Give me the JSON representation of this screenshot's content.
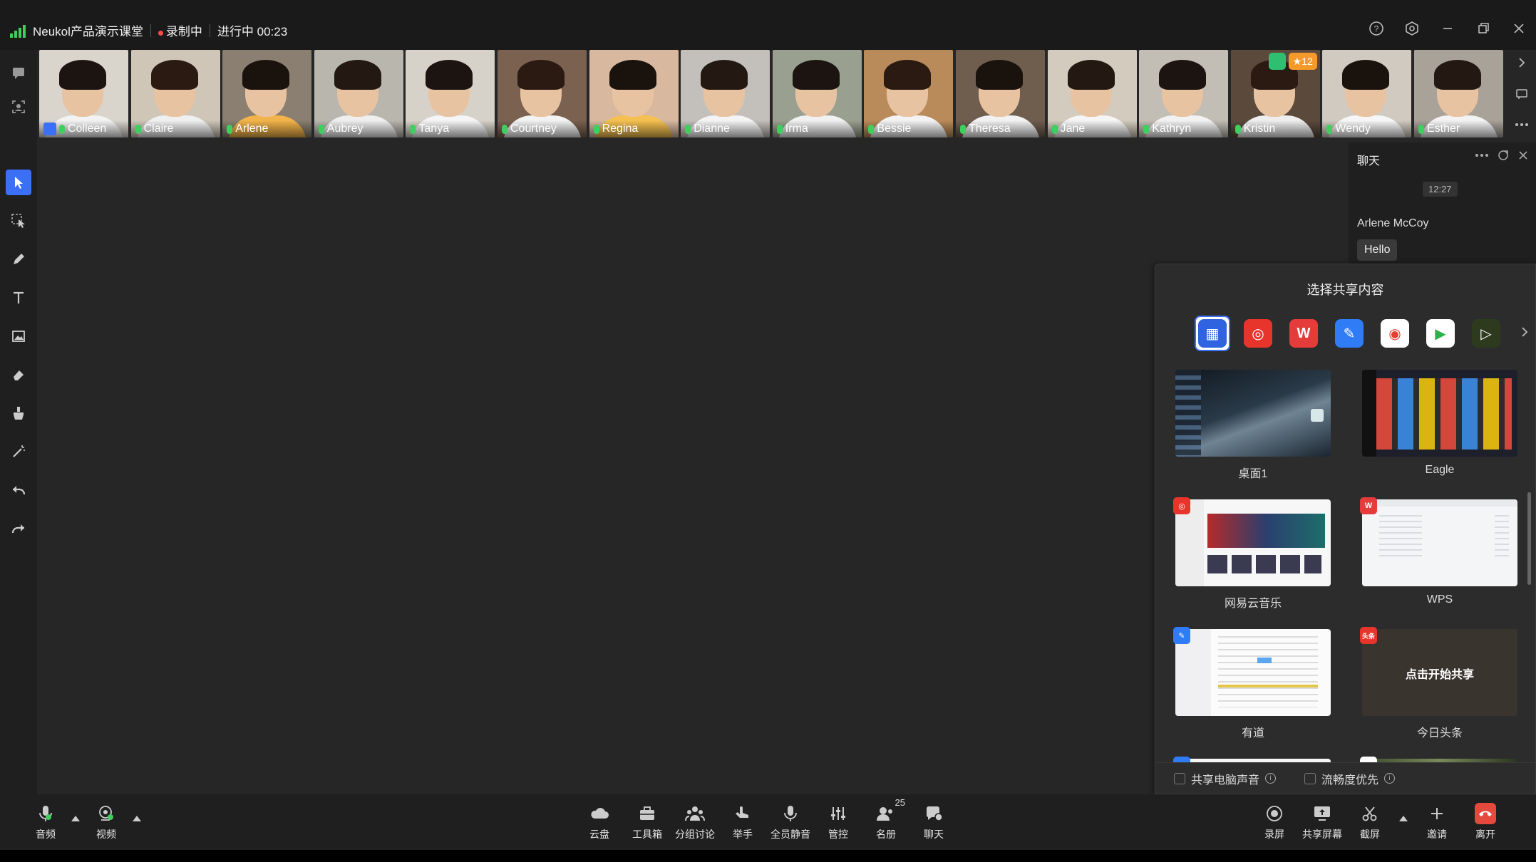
{
  "titlebar": {
    "title": "Neukol产品演示课堂",
    "recording": "录制中",
    "status": "进行中 00:23"
  },
  "participants": [
    {
      "name": "Colleen",
      "host": true,
      "bg": "#d9d4cc",
      "shirt": "#f3f3f3"
    },
    {
      "name": "Claire",
      "host": false,
      "bg": "#cfc6b8",
      "shirt": "#f0f0f0"
    },
    {
      "name": "Arlene",
      "host": false,
      "bg": "#8a7f70",
      "shirt": "#f2b34a"
    },
    {
      "name": "Aubrey",
      "host": false,
      "bg": "#b9b6ae",
      "shirt": "#efefef"
    },
    {
      "name": "Tanya",
      "host": false,
      "bg": "#d7d2c9",
      "shirt": "#f5f5f5"
    },
    {
      "name": "Courtney",
      "host": false,
      "bg": "#7a6150",
      "shirt": "#f3f3f3"
    },
    {
      "name": "Regina",
      "host": false,
      "bg": "#d8b9a0",
      "shirt": "#f5c050"
    },
    {
      "name": "Dianne",
      "host": false,
      "bg": "#c3c0bb",
      "shirt": "#f4f4f4"
    },
    {
      "name": "Irma",
      "host": false,
      "bg": "#9aa08f",
      "shirt": "#f1f1f1"
    },
    {
      "name": "Bessie",
      "host": false,
      "bg": "#b98a5a",
      "shirt": "#f3f3f3"
    },
    {
      "name": "Theresa",
      "host": false,
      "bg": "#6f5d4e",
      "shirt": "#f2f2f2"
    },
    {
      "name": "Jane",
      "host": false,
      "bg": "#d3cbbd",
      "shirt": "#f5f5f5"
    },
    {
      "name": "Kathryn",
      "host": false,
      "bg": "#c2bdb5",
      "shirt": "#f2f2f2"
    },
    {
      "name": "Kristin",
      "host": false,
      "bg": "#5b4a3c",
      "shirt": "#eeeeee"
    },
    {
      "name": "Wendy",
      "host": false,
      "bg": "#d0cac0",
      "shirt": "#f6f6f6"
    },
    {
      "name": "Esther",
      "host": false,
      "bg": "#a9a299",
      "shirt": "#f3f3f3"
    }
  ],
  "kristin_badge": "12",
  "chat": {
    "title": "聊天",
    "time": "12:27",
    "sender": "Arlene McCoy",
    "message": "Hello"
  },
  "share": {
    "title": "选择共享内容",
    "apps": [
      {
        "icon": "grid-icon",
        "color": "#2f63e0",
        "glyph": "▦",
        "selected": true
      },
      {
        "icon": "netease-music-icon",
        "color": "#e8352b",
        "glyph": "◎",
        "selected": false
      },
      {
        "icon": "wps-icon",
        "color": "#e63b3b",
        "glyph": "W",
        "selected": false
      },
      {
        "icon": "youdao-icon",
        "color": "#2f7cf6",
        "glyph": "✎",
        "selected": false
      },
      {
        "icon": "chrome-icon",
        "color": "#ffffff",
        "glyph": "◉",
        "selected": false
      },
      {
        "icon": "player-icon",
        "color": "#ffffff",
        "glyph": "▶",
        "selected": false
      },
      {
        "icon": "terminal-icon",
        "color": "#2d3a1e",
        "glyph": "▷",
        "selected": false
      }
    ],
    "items": [
      {
        "label": "桌面1",
        "corner": "",
        "cornerColor": ""
      },
      {
        "label": "Eagle",
        "corner": "",
        "cornerColor": ""
      },
      {
        "label": "网易云音乐",
        "corner": "◎",
        "cornerColor": "#e8352b"
      },
      {
        "label": "WPS",
        "corner": "W",
        "cornerColor": "#e63b3b"
      },
      {
        "label": "有道",
        "corner": "✎",
        "cornerColor": "#2f7cf6"
      },
      {
        "label": "今日头条",
        "corner": "头条",
        "cornerColor": "#e8352b",
        "overlay": "点击开始共享"
      }
    ],
    "share_audio": "共享电脑声音",
    "smooth_first": "流畅度优先"
  },
  "bottombar": {
    "audio": "音频",
    "video": "视频",
    "cloud": "云盘",
    "toolbox": "工具箱",
    "breakout": "分组讨论",
    "raise_hand": "举手",
    "mute_all": "全员静音",
    "control": "管控",
    "roster": "名册",
    "roster_count": "25",
    "chat": "聊天",
    "record": "录屏",
    "share_screen": "共享屏幕",
    "screenshot": "截屏",
    "invite": "邀请",
    "leave": "离开"
  }
}
